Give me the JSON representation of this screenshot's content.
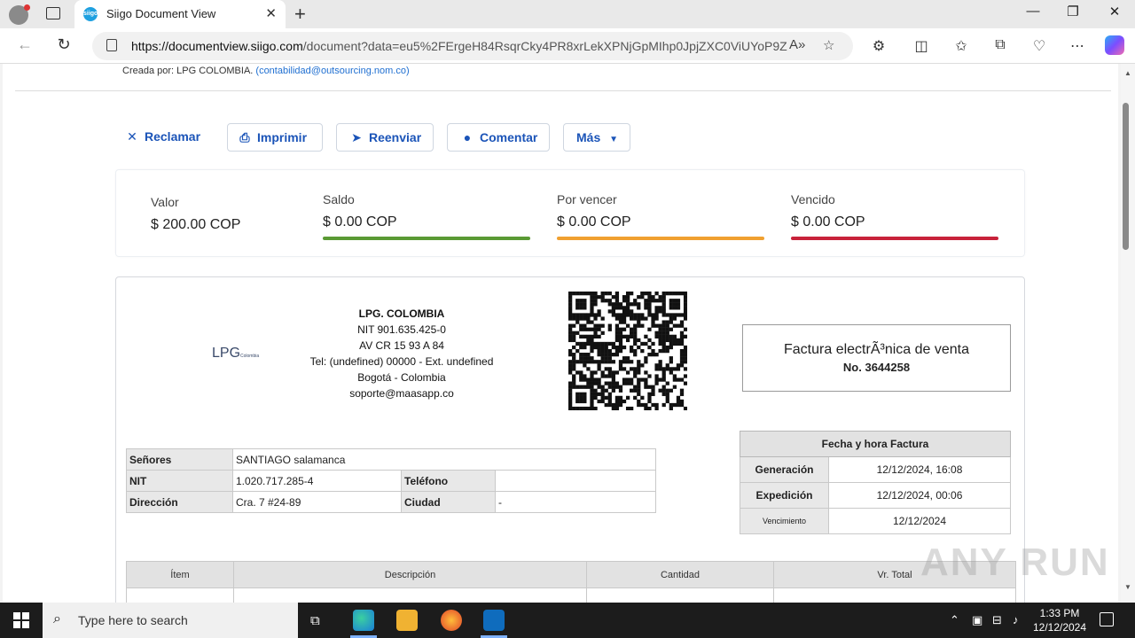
{
  "browser": {
    "tab_title": "Siigo Document View",
    "tab_favicon": "siigo",
    "url_host": "https://documentview.siigo.com",
    "url_path": "/document?data=eu5%2FErgeH84RsqrCky4PR8xrLekXPNjGpMIhp0JpjZXC0ViUYoP9Z...",
    "window_controls": [
      "minimize",
      "maximize",
      "close"
    ]
  },
  "page": {
    "created_by_prefix": "Creada por: LPG COLOMBIA.",
    "created_by_email": "(contabilidad@outsourcing.nom.co)",
    "actions": [
      {
        "label": "Reclamar",
        "icon": "close-icon"
      },
      {
        "label": "Imprimir",
        "icon": "print-icon"
      },
      {
        "label": "Reenviar",
        "icon": "send-icon"
      },
      {
        "label": "Comentar",
        "icon": "comment-icon"
      },
      {
        "label": "Más",
        "icon": "chevron-down-icon"
      }
    ],
    "summary": [
      {
        "label": "Valor",
        "value": "$ 200.00 COP"
      },
      {
        "label": "Saldo",
        "value": "$ 0.00 COP",
        "color": "#5a9a34"
      },
      {
        "label": "Por vencer",
        "value": "$ 0.00 COP",
        "color": "#f0a030"
      },
      {
        "label": "Vencido",
        "value": "$ 0.00 COP",
        "color": "#c8223a"
      }
    ]
  },
  "invoice": {
    "logo_text": "LPG",
    "logo_sub": "Colombia",
    "company": {
      "name": "LPG. COLOMBIA",
      "nit": "NIT 901.635.425-0",
      "address": "AV CR 15 93 A 84",
      "phone": "Tel: (undefined) 00000 - Ext. undefined",
      "city": "Bogotá - Colombia",
      "email": "soporte@maasapp.co"
    },
    "doc_type": "Factura electrÃ³nica de venta",
    "doc_number": "No. 3644258",
    "client": {
      "senores_label": "Señores",
      "senores_value": "SANTIAGO salamanca",
      "nit_label": "NIT",
      "nit_value": "1.020.717.285-4",
      "telefono_label": "Teléfono",
      "telefono_value": "",
      "direccion_label": "Dirección",
      "direccion_value": "Cra. 7 #24-89",
      "ciudad_label": "Ciudad",
      "ciudad_value": "-"
    },
    "dates": {
      "header": "Fecha y hora Factura",
      "generacion_label": "Generación",
      "generacion_value": "12/12/2024, 16:08",
      "expedicion_label": "Expedición",
      "expedicion_value": "12/12/2024, 00:06",
      "vencimiento_label": "Vencimiento",
      "vencimiento_value": "12/12/2024"
    },
    "items_headers": [
      "Ítem",
      "Descripción",
      "Cantidad",
      "Vr. Total"
    ]
  },
  "watermark": "ANY RUN",
  "taskbar": {
    "search_placeholder": "Type here to search",
    "time": "1:33 PM",
    "date": "12/12/2024"
  }
}
